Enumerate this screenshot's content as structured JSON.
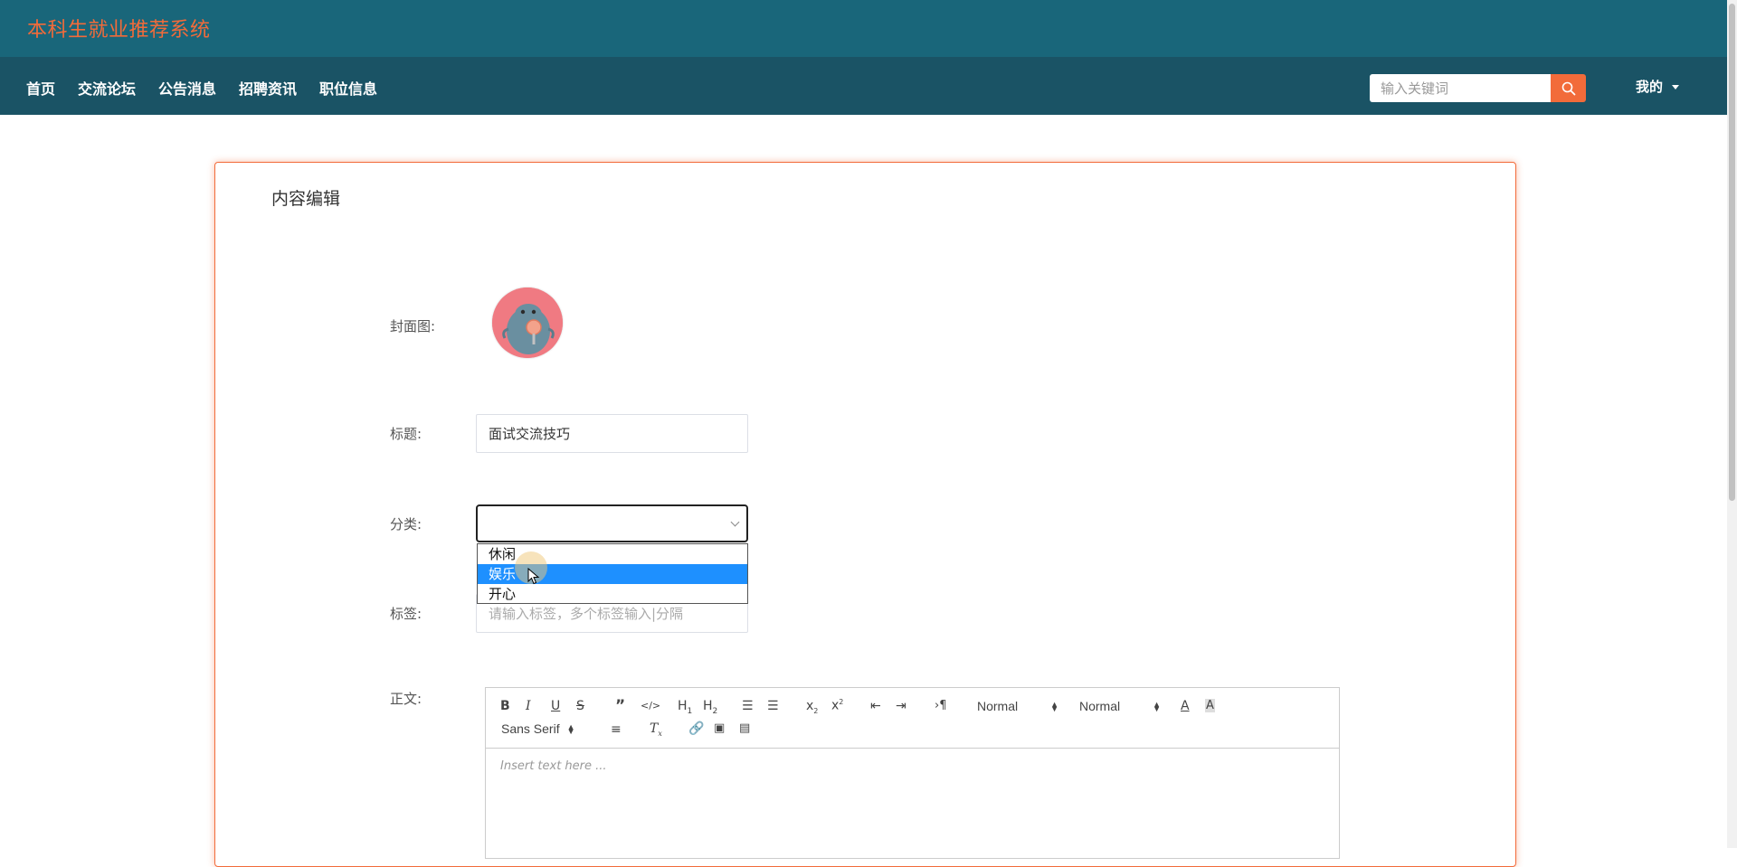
{
  "header": {
    "site_title": "本科生就业推荐系统"
  },
  "nav": {
    "items": [
      {
        "label": "首页"
      },
      {
        "label": "交流论坛"
      },
      {
        "label": "公告消息"
      },
      {
        "label": "招聘资讯"
      },
      {
        "label": "职位信息"
      }
    ],
    "search_placeholder": "输入关键词",
    "user_menu_label": "我的"
  },
  "form": {
    "heading": "内容编辑",
    "cover_label": "封面图:",
    "title_label": "标题:",
    "title_value": "面试交流技巧",
    "category_label": "分类:",
    "category_value": "",
    "category_options": [
      "休闲",
      "娱乐",
      "开心"
    ],
    "category_highlighted": "娱乐",
    "tags_label": "标签:",
    "tags_placeholder": "请输入标签，多个标签输入|分隔",
    "body_label": "正文:"
  },
  "editor": {
    "header_select": "Normal",
    "size_select": "Normal",
    "font_select": "Sans Serif",
    "placeholder": "Insert text here ..."
  },
  "colors": {
    "accent": "#f26b3a",
    "topbar": "#19667a",
    "navbar": "#1a5365",
    "highlight": "#1e90ff"
  }
}
